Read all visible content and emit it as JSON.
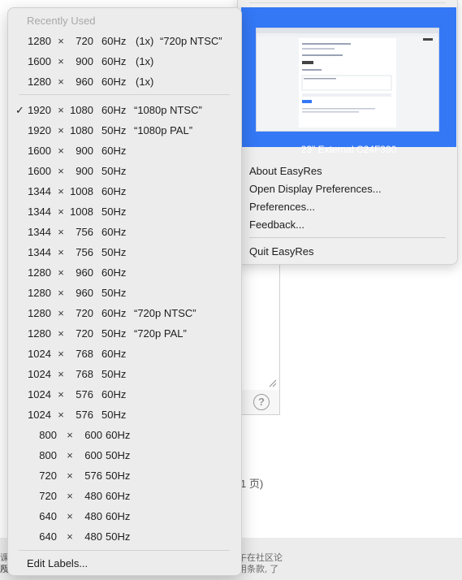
{
  "background": {
    "help_symbol": "?",
    "page_text": "1 页)",
    "footer_line1": "午在社区论",
    "footer_line2": "用条款, 了",
    "left_line1": "课及",
    "left_line2": "所"
  },
  "panel": {
    "display_name": "23\" External C24F390",
    "items": [
      {
        "label": "About EasyRes"
      },
      {
        "label": "Open Display Preferences..."
      },
      {
        "label": "Preferences..."
      },
      {
        "label": "Feedback..."
      }
    ],
    "quit_label": "Quit EasyRes"
  },
  "menu": {
    "header": "Recently Used",
    "recent": [
      {
        "w": "1280",
        "h": "720",
        "hz": "60Hz",
        "extra": "(1x)",
        "label": "“720p NTSC”"
      },
      {
        "w": "1600",
        "h": "900",
        "hz": "60Hz",
        "extra": "(1x)",
        "label": ""
      },
      {
        "w": "1280",
        "h": "960",
        "hz": "60Hz",
        "extra": "(1x)",
        "label": ""
      }
    ],
    "checkmark": "✓",
    "modes": [
      {
        "w": "1920",
        "h": "1080",
        "hz": "60Hz",
        "label": "“1080p NTSC”",
        "selected": true
      },
      {
        "w": "1920",
        "h": "1080",
        "hz": "50Hz",
        "label": "“1080p PAL”"
      },
      {
        "w": "1600",
        "h": "900",
        "hz": "60Hz",
        "label": ""
      },
      {
        "w": "1600",
        "h": "900",
        "hz": "50Hz",
        "label": ""
      },
      {
        "w": "1344",
        "h": "1008",
        "hz": "60Hz",
        "label": ""
      },
      {
        "w": "1344",
        "h": "1008",
        "hz": "50Hz",
        "label": ""
      },
      {
        "w": "1344",
        "h": "756",
        "hz": "60Hz",
        "label": ""
      },
      {
        "w": "1344",
        "h": "756",
        "hz": "50Hz",
        "label": ""
      },
      {
        "w": "1280",
        "h": "960",
        "hz": "60Hz",
        "label": ""
      },
      {
        "w": "1280",
        "h": "960",
        "hz": "50Hz",
        "label": ""
      },
      {
        "w": "1280",
        "h": "720",
        "hz": "60Hz",
        "label": "“720p NTSC”"
      },
      {
        "w": "1280",
        "h": "720",
        "hz": "50Hz",
        "label": "“720p PAL”"
      },
      {
        "w": "1024",
        "h": "768",
        "hz": "60Hz",
        "label": ""
      },
      {
        "w": "1024",
        "h": "768",
        "hz": "50Hz",
        "label": ""
      },
      {
        "w": "1024",
        "h": "576",
        "hz": "60Hz",
        "label": ""
      },
      {
        "w": "1024",
        "h": "576",
        "hz": "50Hz",
        "label": ""
      },
      {
        "w": "800",
        "h": "600",
        "hz": "60Hz",
        "label": ""
      },
      {
        "w": "800",
        "h": "600",
        "hz": "50Hz",
        "label": ""
      },
      {
        "w": "720",
        "h": "576",
        "hz": "50Hz",
        "label": ""
      },
      {
        "w": "720",
        "h": "480",
        "hz": "60Hz",
        "label": ""
      },
      {
        "w": "640",
        "h": "480",
        "hz": "60Hz",
        "label": ""
      },
      {
        "w": "640",
        "h": "480",
        "hz": "50Hz",
        "label": ""
      }
    ],
    "times": "×",
    "edit_labels": "Edit Labels..."
  }
}
